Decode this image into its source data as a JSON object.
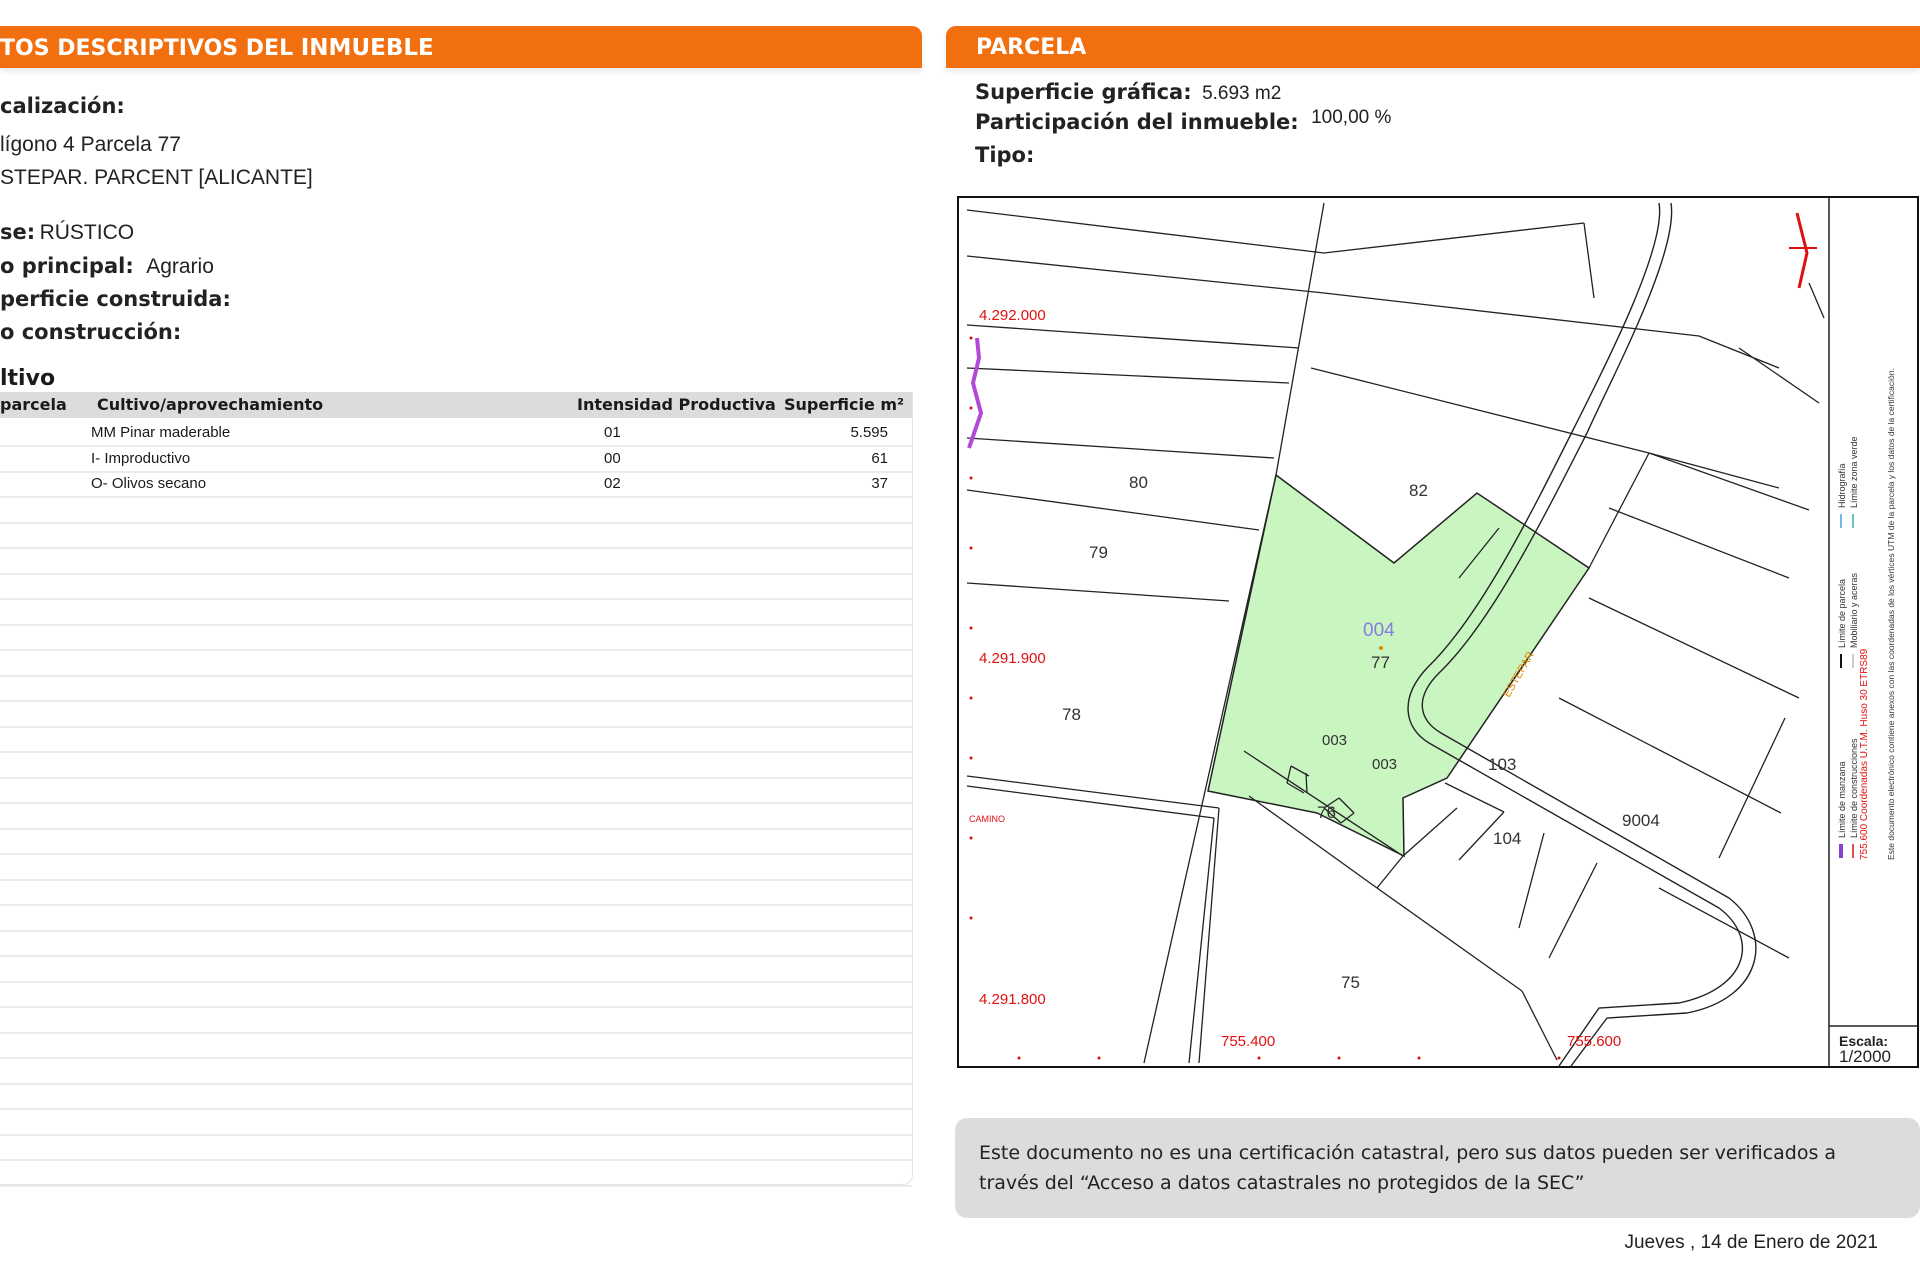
{
  "left_header": {
    "part1": "TOS DESCRIPTIVOS DEL ",
    "part2": "INMUEBLE"
  },
  "right_header": "PARCELA",
  "localizacion": {
    "label": "calización:",
    "line1": "lígono 4 Parcela 77",
    "line2": "STEPAR. PARCENT [ALICANTE]"
  },
  "clase": {
    "label": "se:",
    "value": "RÚSTICO"
  },
  "uso": {
    "label": "o principal:",
    "value": "Agrario"
  },
  "superficie_construida": {
    "label": "perficie construida:"
  },
  "ano_construccion": {
    "label": "o construcción:"
  },
  "cultivo": {
    "title": "ltivo",
    "headers": [
      "parcela",
      "Cultivo/aprovechamiento",
      "Intensidad Productiva",
      "Superficie m²"
    ],
    "rows": [
      {
        "cultivo": "MM Pinar maderable",
        "intensidad": "01",
        "superficie": "5.595"
      },
      {
        "cultivo": "I- Improductivo",
        "intensidad": "00",
        "superficie": "61"
      },
      {
        "cultivo": "O- Olivos secano",
        "intensidad": "02",
        "superficie": "37"
      }
    ]
  },
  "parcela": {
    "superficie_label": "Superficie gráfica:",
    "superficie_value": "5.693 m2",
    "participacion_label": "Participación del inmueble:",
    "participacion_value": "100,00 %",
    "tipo_label": "Tipo:"
  },
  "map": {
    "coord_y": [
      "4.292.000",
      "4.291.900",
      "4.291.800"
    ],
    "coord_x": [
      "755.400",
      "755.600"
    ],
    "parcel_labels": [
      "80",
      "82",
      "79",
      "78",
      "76",
      "75",
      "103",
      "104",
      "9004"
    ],
    "main_parcel": {
      "code": "004",
      "number": "77"
    },
    "sub_labels": [
      "003",
      "003"
    ],
    "road_label": "ESTEPAR",
    "camino_label": "CAMINO",
    "legend": {
      "col1": [
        "Límite de manzana",
        "Límite de construcciones"
      ],
      "col2": [
        "Límite de parcela",
        "Mobiliario y aceras"
      ],
      "col3": [
        "Hidrografía",
        "Límite zona verde"
      ],
      "coords_note": "755.600 Coordenadas U.T.M. Huso 30 ETRS89",
      "doc_note": "Este documento electrónico contiene anexos con las coordenadas de los vértices UTM de la parcela y los datos de la certificación."
    },
    "scale_label": "Escala:",
    "scale_value": "1/2000",
    "colors": {
      "parcel_fill": "#c9f5c0",
      "coord_red": "#e01010",
      "label_purple": "#8a7de0",
      "road_orange": "#e08a00"
    }
  },
  "note": "Este documento no es una certificación catastral, pero sus datos pueden ser verificados a través del “Acceso a datos catastrales no protegidos de la SEC”",
  "date": "Jueves , 14 de Enero de 2021",
  "colors": {
    "accent": "#f26f10",
    "table_header": "#dcdcdc",
    "note_bg": "#dcdcdc"
  }
}
